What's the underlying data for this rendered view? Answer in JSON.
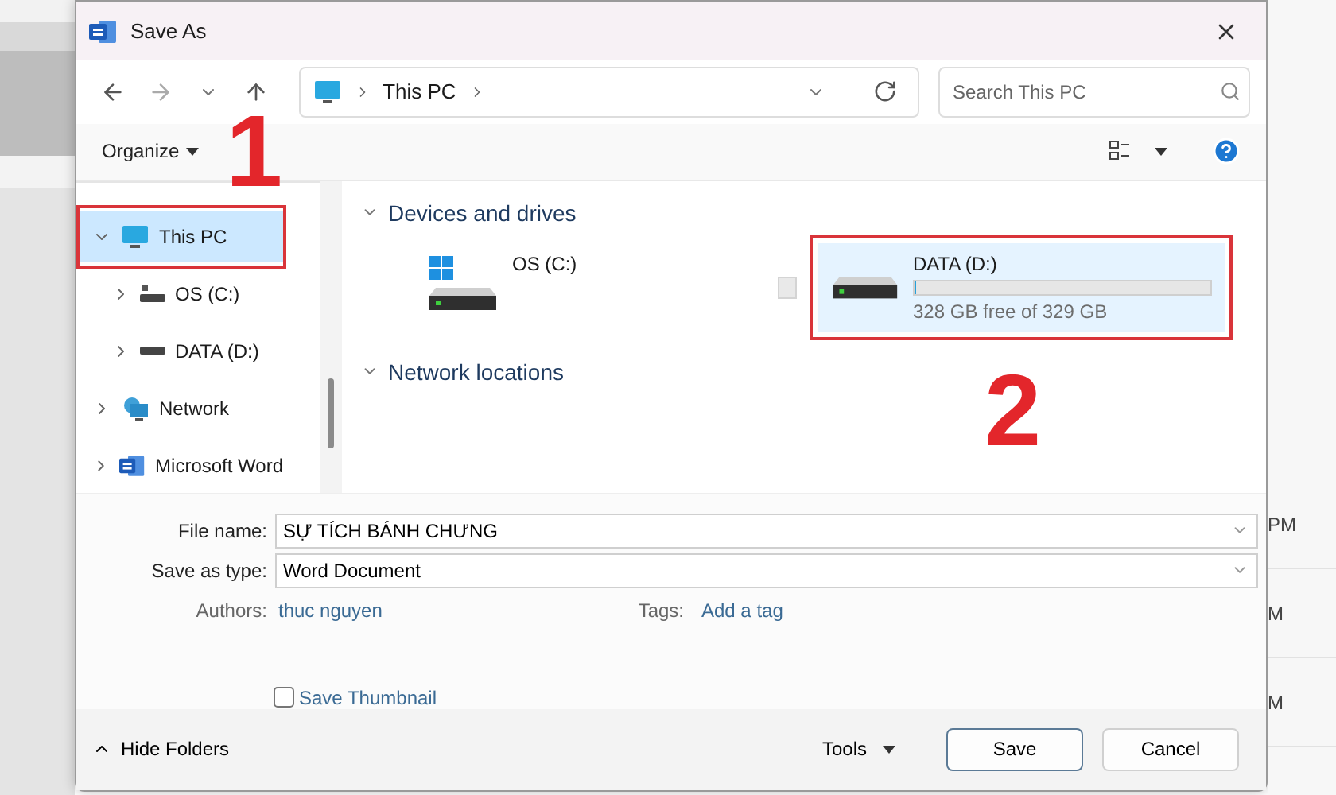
{
  "window": {
    "title": "Save As"
  },
  "address_bar": {
    "path": [
      "This PC"
    ]
  },
  "search": {
    "placeholder": "Search This PC"
  },
  "command_bar": {
    "organize": "Organize"
  },
  "sidebar": {
    "items": [
      {
        "label": "This PC",
        "kind": "computer",
        "selected": true,
        "expanded": true,
        "highlighted": true,
        "children": [
          {
            "label": "OS (C:)",
            "kind": "system-drive",
            "selected": false,
            "expanded": false,
            "highlighted": false
          },
          {
            "label": "DATA (D:)",
            "kind": "drive",
            "selected": false,
            "expanded": false,
            "highlighted": false
          }
        ]
      },
      {
        "label": "Network",
        "kind": "network",
        "selected": false,
        "expanded": false,
        "highlighted": false
      },
      {
        "label": "Microsoft Word",
        "kind": "word",
        "selected": false,
        "expanded": false,
        "highlighted": false
      }
    ]
  },
  "sections": [
    {
      "title": "Devices and drives",
      "expanded": true,
      "drives": [
        {
          "name": "OS (C:)",
          "kind": "windows",
          "selected": false,
          "checked": false,
          "highlighted": false
        },
        {
          "name": "DATA (D:)",
          "kind": "plain",
          "selected": true,
          "checked": false,
          "highlighted": true,
          "level": 0.003,
          "free": "328 GB free of 329 GB"
        }
      ]
    },
    {
      "title": "Network locations",
      "expanded": true
    }
  ],
  "form": {
    "file_name_label": "File name:",
    "file_name": "SỰ TÍCH BÁNH CHƯNG",
    "type_label": "Save as type:",
    "type": "Word Document",
    "authors_label": "Authors:",
    "authors": "thuc nguyen",
    "tags_label": "Tags:",
    "tags": "Add a tag",
    "thumbnail": {
      "label": "Save Thumbnail",
      "checked": false
    }
  },
  "footer": {
    "hide_folders": "Hide Folders",
    "tools": "Tools",
    "save": "Save",
    "cancel": "Cancel"
  },
  "annotations": [
    {
      "label": "1"
    },
    {
      "label": "2"
    }
  ],
  "background": {
    "times": [
      "PM",
      "M",
      "M"
    ]
  }
}
